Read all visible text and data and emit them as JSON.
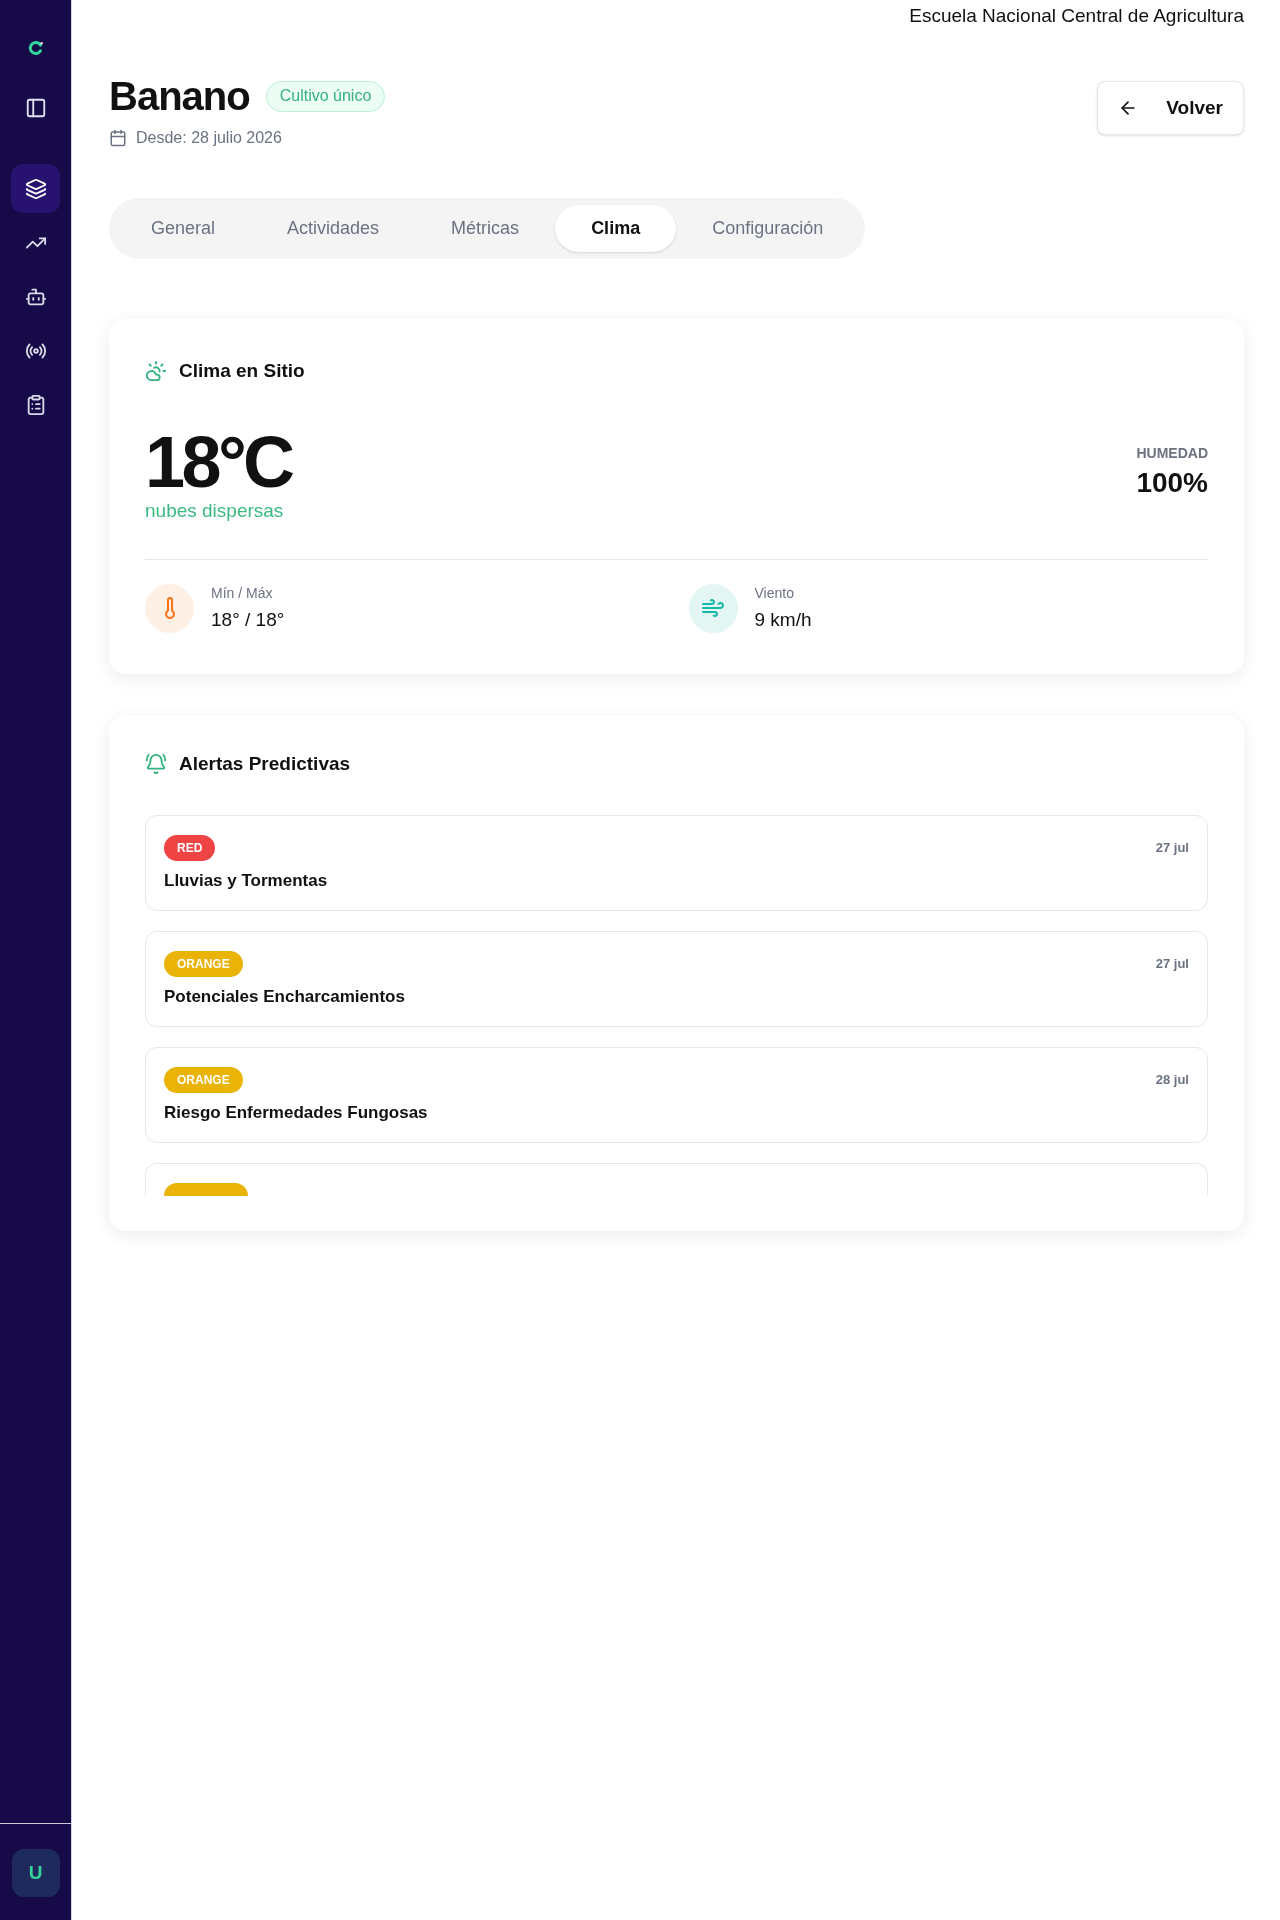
{
  "org_name": "Escuela Nacional Central de Agricultura",
  "sidebar": {
    "items": [
      {
        "kind": "layers",
        "selected": true
      },
      {
        "kind": "trending",
        "selected": false
      },
      {
        "kind": "bot",
        "selected": false
      },
      {
        "kind": "radio",
        "selected": false
      },
      {
        "kind": "clipboard",
        "selected": false
      }
    ],
    "user_initial": "U"
  },
  "header": {
    "title": "Banano",
    "badge": "Cultivo único",
    "since": "Desde: 28 julio 2026",
    "back_button": "Volver"
  },
  "tabs": [
    {
      "label": "General",
      "selected": false
    },
    {
      "label": "Actividades",
      "selected": false
    },
    {
      "label": "Métricas",
      "selected": false
    },
    {
      "label": "Clima",
      "selected": true
    },
    {
      "label": "Configuración",
      "selected": false
    }
  ],
  "weather": {
    "title": "Clima en Sitio",
    "temperature": "18°C",
    "description": "nubes dispersas",
    "humidity_label": "HUMEDAD",
    "humidity": "100%",
    "stats": [
      {
        "kind": "temperature",
        "label": "Mín / Máx",
        "value": "18° / 18°"
      },
      {
        "kind": "wind",
        "label": "Viento",
        "value": "9 km/h"
      }
    ]
  },
  "alerts": {
    "title": "Alertas Predictivas",
    "items": [
      {
        "kind": "alert",
        "level": "RED",
        "color": "#ef4444",
        "title": "Lluvias y Tormentas",
        "date": "27 jul"
      },
      {
        "kind": "alert",
        "level": "ORANGE",
        "color": "#eab308",
        "title": "Potenciales Encharcamientos",
        "date": "27 jul"
      },
      {
        "kind": "alert",
        "level": "ORANGE",
        "color": "#eab308",
        "title": "Riesgo Enfermedades Fungosas",
        "date": "28 jul"
      },
      {
        "kind": "clipped",
        "color": "#eab308"
      }
    ]
  }
}
